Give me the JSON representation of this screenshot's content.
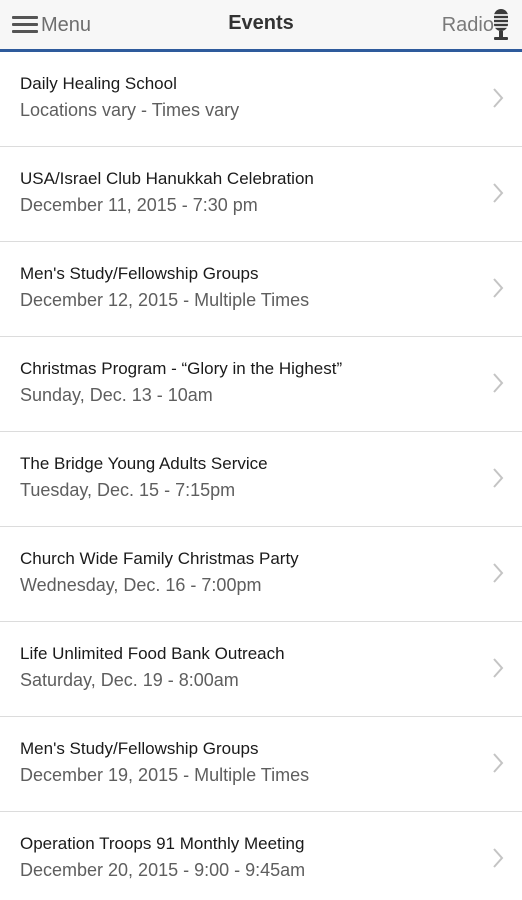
{
  "navbar": {
    "menu_label": "Menu",
    "title": "Events",
    "radio_label": "Radio",
    "accent_color": "#2e5b9c"
  },
  "icons": {
    "menu": "hamburger-icon",
    "radio": "microphone-icon",
    "row_arrow": "chevron-right-icon"
  },
  "events": [
    {
      "title": "Daily Healing School",
      "subtitle": "Locations vary - Times vary"
    },
    {
      "title": "USA/Israel Club Hanukkah Celebration",
      "subtitle": "December 11, 2015 - 7:30 pm"
    },
    {
      "title": "Men's Study/Fellowship Groups",
      "subtitle": "December 12, 2015 - Multiple Times"
    },
    {
      "title": "Christmas Program - “Glory in the Highest”",
      "subtitle": "Sunday, Dec. 13 - 10am"
    },
    {
      "title": "The Bridge Young Adults Service",
      "subtitle": "Tuesday, Dec. 15 - 7:15pm"
    },
    {
      "title": "Church Wide Family Christmas Party",
      "subtitle": "Wednesday, Dec. 16 - 7:00pm"
    },
    {
      "title": "Life Unlimited Food Bank Outreach",
      "subtitle": "Saturday, Dec. 19 - 8:00am"
    },
    {
      "title": "Men's Study/Fellowship Groups",
      "subtitle": "December 19, 2015 - Multiple Times"
    },
    {
      "title": "Operation Troops 91 Monthly Meeting",
      "subtitle": "December 20, 2015 - 9:00 - 9:45am"
    }
  ]
}
